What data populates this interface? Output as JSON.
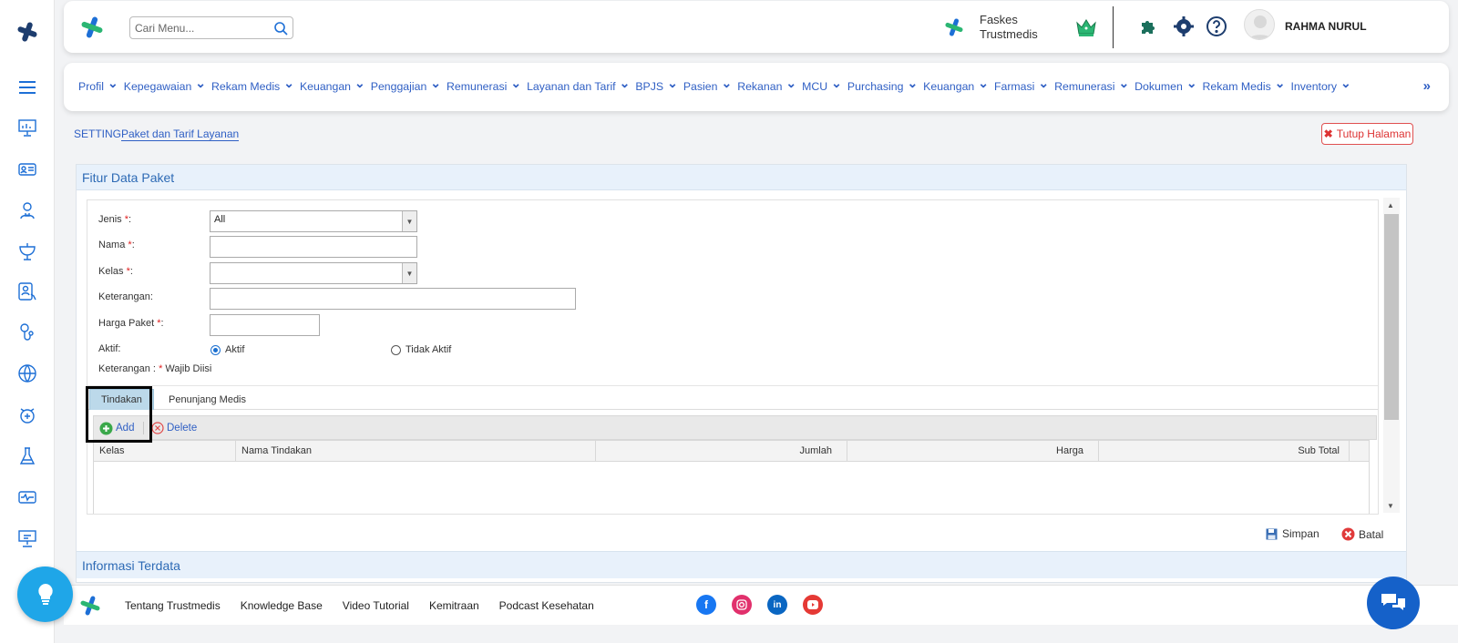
{
  "header": {
    "search_placeholder": "Cari Menu...",
    "faskes_line1": "Faskes",
    "faskes_line2": "Trustmedis",
    "user_name": "RAHMA NURUL"
  },
  "menu": {
    "items": [
      "Profil",
      "Kepegawaian",
      "Rekam Medis",
      "Keuangan",
      "Penggajian",
      "Remunerasi",
      "Layanan dan Tarif",
      "BPJS",
      "Pasien",
      "Rekanan",
      "MCU",
      "Purchasing",
      "Keuangan",
      "Farmasi",
      "Remunerasi",
      "Dokumen",
      "Rekam Medis",
      "Inventory"
    ],
    "more": "»"
  },
  "breadcrumb": {
    "section": "SETTING",
    "page": "Paket dan Tarif Layanan",
    "close_label": "Tutup Halaman"
  },
  "panel": {
    "title": "Fitur Data Paket",
    "form": {
      "jenis_label": "Jenis",
      "jenis_value": "All",
      "nama_label": "Nama",
      "kelas_label": "Kelas",
      "keterangan_label": "Keterangan:",
      "harga_label": "Harga Paket",
      "aktif_label": "Aktif:",
      "opt_aktif": "Aktif",
      "opt_tidak_aktif": "Tidak Aktif",
      "selected": "Aktif",
      "note_prefix": "Keterangan : ",
      "note_text": " Wajib Diisi",
      "star": "*",
      "colon": ":"
    },
    "tabs": [
      "Tindakan",
      "Penunjang Medis"
    ],
    "active_tab": "Tindakan",
    "toolbar": {
      "add": "Add",
      "delete": "Delete"
    },
    "columns": [
      "Kelas",
      "Nama Tindakan",
      "Jumlah",
      "Harga",
      "Sub Total"
    ],
    "rows": [],
    "save": "Simpan",
    "cancel": "Batal",
    "info_title": "Informasi Terdata"
  },
  "footer": {
    "links": [
      "Tentang Trustmedis",
      "Knowledge Base",
      "Video Tutorial",
      "Kemitraan",
      "Podcast Kesehatan"
    ]
  },
  "colors": {
    "brand_green": "#2bb673",
    "brand_blue": "#1d6fd6",
    "link_blue": "#2f5fc4",
    "danger": "#d33333"
  }
}
